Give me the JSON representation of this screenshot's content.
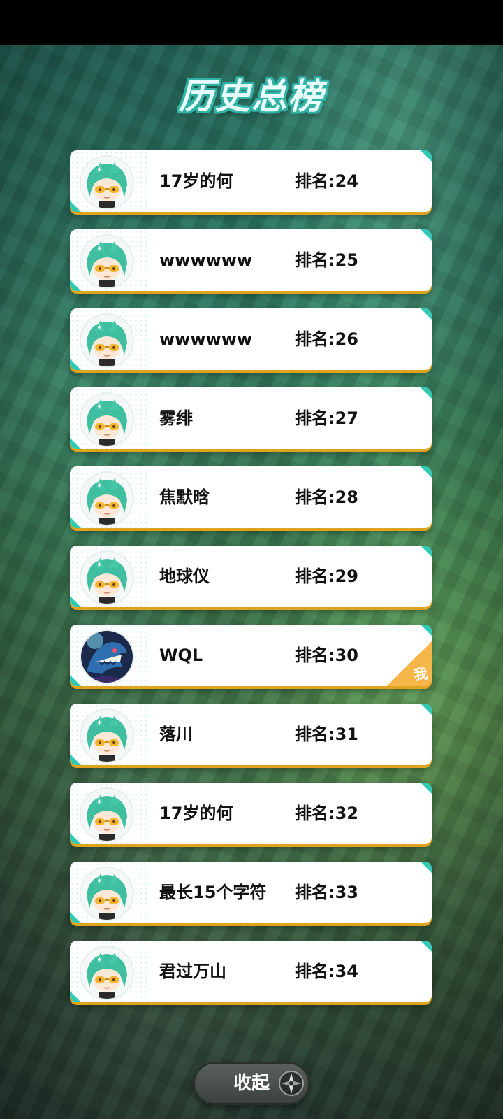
{
  "title": "历史总榜",
  "entries": [
    {
      "name": "17岁的何",
      "rank": "排名:24",
      "avatar": "green-hair-avatar",
      "is_me": false
    },
    {
      "name": "wwwwww",
      "rank": "排名:25",
      "avatar": "green-hair-avatar",
      "is_me": false
    },
    {
      "name": "wwwwww",
      "rank": "排名:26",
      "avatar": "green-hair-avatar",
      "is_me": false
    },
    {
      "name": "雾绯",
      "rank": "排名:27",
      "avatar": "green-hair-avatar",
      "is_me": false
    },
    {
      "name": "焦默晗",
      "rank": "排名:28",
      "avatar": "green-hair-avatar",
      "is_me": false
    },
    {
      "name": "地球仪",
      "rank": "排名:29",
      "avatar": "green-hair-avatar",
      "is_me": false
    },
    {
      "name": "WQL",
      "rank": "排名:30",
      "avatar": "shark-avatar",
      "is_me": true,
      "me_label": "我"
    },
    {
      "name": "落川",
      "rank": "排名:31",
      "avatar": "green-hair-avatar",
      "is_me": false
    },
    {
      "name": "17岁的何",
      "rank": "排名:32",
      "avatar": "green-hair-avatar",
      "is_me": false
    },
    {
      "name": "最长15个字符",
      "rank": "排名:33",
      "avatar": "green-hair-avatar",
      "is_me": false
    },
    {
      "name": "君过万山",
      "rank": "排名:34",
      "avatar": "green-hair-avatar",
      "is_me": false
    }
  ],
  "collapse_label": "收起",
  "colors": {
    "accent_teal": "#2fc9b4",
    "card_border_gold": "#e0a31f",
    "me_badge": "#f6b64a"
  }
}
